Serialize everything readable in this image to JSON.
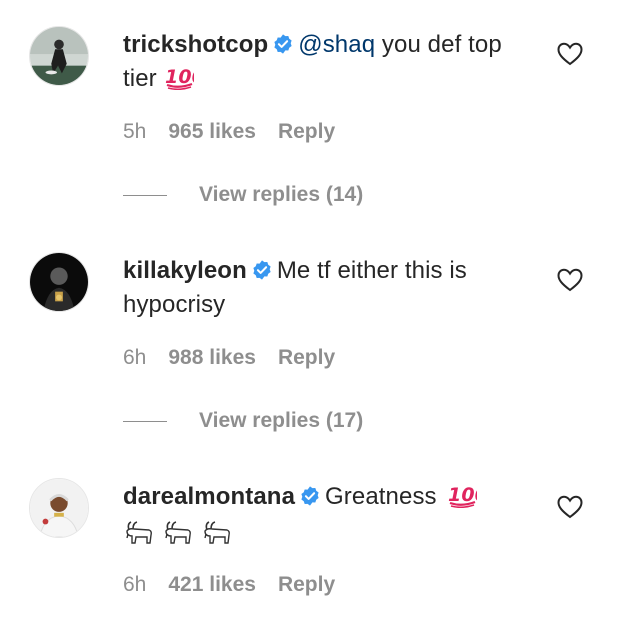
{
  "colors": {
    "verified": "#3897f0",
    "meta": "#8e8e8e",
    "text": "#262626",
    "mention": "#00376b"
  },
  "comments": [
    {
      "username": "trickshotcop",
      "mention": "@shaq",
      "text_before": " ",
      "text_after": " you def top tier",
      "emoji": "100-emoji",
      "time": "5h",
      "likes": "965 likes",
      "reply": "Reply",
      "view_replies": "View replies (14)"
    },
    {
      "username": "killakyleon",
      "text": "Me tf either this is hypocrisy",
      "time": "6h",
      "likes": "988 likes",
      "reply": "Reply",
      "view_replies": "View replies (17)"
    },
    {
      "username": "darealmontana",
      "text": "Greatness",
      "emoji": "100-emoji",
      "emoji_row": [
        "goat-emoji",
        "goat-emoji",
        "goat-emoji"
      ],
      "time": "6h",
      "likes": "421 likes",
      "reply": "Reply"
    }
  ]
}
